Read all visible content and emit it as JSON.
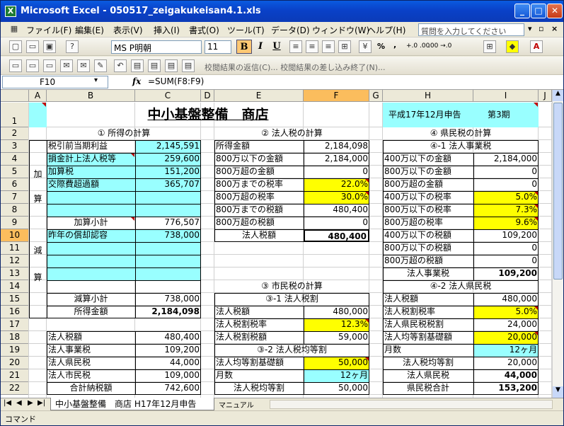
{
  "window": {
    "title": "Microsoft Excel - 050517_zeigakukeisan4.1.xls",
    "minimize": "_",
    "maximize": "□",
    "close": "✕"
  },
  "menu": {
    "items": [
      "ファイル(F)",
      "編集(E)",
      "表示(V)",
      "挿入(I)",
      "書式(O)",
      "ツール(T)",
      "データ(D)",
      "ウィンドウ(W)",
      "ヘルプ(H)"
    ],
    "help_placeholder": "質問を入力してください"
  },
  "toolbar": {
    "font_name": "MS P明朝",
    "font_size": "11",
    "bold": "B",
    "italic": "I",
    "underline": "U",
    "percent": "%",
    "comma": ",",
    "inc_dec": "+.0 .00",
    "dec_dec": ".00 →.0",
    "review_text": "校閲結果の返信(C)...  校閲結果の差し込み終了(N)..."
  },
  "formula_bar": {
    "name_box": "F10",
    "fx": "fx",
    "formula": "=SUM(F8:F9)"
  },
  "columns": [
    "A",
    "B",
    "C",
    "D",
    "E",
    "F",
    "G",
    "H",
    "I",
    "J"
  ],
  "rows": [
    "1",
    "2",
    "3",
    "4",
    "5",
    "6",
    "7",
    "8",
    "9",
    "10",
    "11",
    "12",
    "13",
    "14",
    "15",
    "16",
    "17",
    "18",
    "19",
    "20",
    "21",
    "22"
  ],
  "sheet": {
    "title": "中小基盤整備　商店",
    "period": "平成17年12月申告",
    "term": "第3期",
    "sec1": {
      "header": "① 所得の計算",
      "pretax_label": "税引前当期利益",
      "pretax_value": "2,145,591",
      "add_chars": [
        "加",
        "算"
      ],
      "sub_chars": [
        "減",
        "算"
      ],
      "add_items": [
        {
          "label": "損金計上法人税等",
          "value": "259,600"
        },
        {
          "label": "加算税",
          "value": "151,200"
        },
        {
          "label": "交際費超過額",
          "value": "365,707"
        },
        {
          "label": "",
          "value": ""
        },
        {
          "label": "",
          "value": ""
        }
      ],
      "add_subtotal_label": "加算小計",
      "add_subtotal_value": "776,507",
      "sub_items": [
        {
          "label": "昨年の償却認容",
          "value": "738,000"
        },
        {
          "label": "",
          "value": ""
        },
        {
          "label": "",
          "value": ""
        },
        {
          "label": "",
          "value": ""
        }
      ],
      "sub_subtotal_label": "減算小計",
      "sub_subtotal_value": "738,000",
      "income_label": "所得金額",
      "income_value": "2,184,098",
      "summary": [
        {
          "label": "法人税額",
          "value": "480,400"
        },
        {
          "label": "法人事業税",
          "value": "109,200"
        },
        {
          "label": "法人県民税",
          "value": "44,000"
        },
        {
          "label": "法人市民税",
          "value": "109,000"
        }
      ],
      "total_label": "合計納税額",
      "total_value": "742,600"
    },
    "sec2": {
      "header": "② 法人税の計算",
      "rows": [
        {
          "label": "所得金額",
          "value": "2,184,098"
        },
        {
          "label": "800万以下の金額",
          "value": "2,184,000"
        },
        {
          "label": "800万超の金額",
          "value": "0"
        },
        {
          "label": "800万までの税率",
          "value": "22.0%"
        },
        {
          "label": "800万超の税率",
          "value": "30.0%"
        },
        {
          "label": "800万までの税額",
          "value": "480,400"
        },
        {
          "label": "800万超の税額",
          "value": "0"
        }
      ],
      "total_label": "法人税額",
      "total_value": "480,400"
    },
    "sec3": {
      "header": "③ 市民税の計算",
      "sub1_header": "③-1 法人税割",
      "sub1_rows": [
        {
          "label": "法人税額",
          "value": "480,000"
        },
        {
          "label": "法人税割税率",
          "value": "12.3%"
        },
        {
          "label": "法人税割税額",
          "value": "59,000"
        }
      ],
      "sub2_header": "③-2 法人税均等割",
      "sub2_rows": [
        {
          "label": "法人均等割基礎額",
          "value": "50,000"
        },
        {
          "label": "月数",
          "value": "12ヶ月"
        }
      ],
      "per_capita_label": "法人税均等割",
      "per_capita_value": "50,000",
      "total_label": "法人市民税",
      "total_value": "109,000"
    },
    "sec4": {
      "header": "④ 県民税の計算",
      "sub1_header": "④-1 法人事業税",
      "sub1_rows": [
        {
          "label": "400万以下の金額",
          "value": "2,184,000"
        },
        {
          "label": "800万以下の金額",
          "value": "0"
        },
        {
          "label": "800万超の金額",
          "value": "0"
        },
        {
          "label": "400万以下の税率",
          "value": "5.0%"
        },
        {
          "label": "800万以下の税率",
          "value": "7.3%"
        },
        {
          "label": "800万超の税率",
          "value": "9.6%"
        },
        {
          "label": "400万以下の税額",
          "value": "109,200"
        },
        {
          "label": "800万以下の税額",
          "value": "0"
        },
        {
          "label": "800万超の税額",
          "value": "0"
        }
      ],
      "enterprise_label": "法人事業税",
      "enterprise_value": "109,200",
      "sub2_header": "④-2 法人県民税",
      "sub2_rows": [
        {
          "label": "法人税額",
          "value": "480,000"
        },
        {
          "label": "法人税割税率",
          "value": "5.0%"
        },
        {
          "label": "法人県民税税割",
          "value": "24,000"
        },
        {
          "label": "法人均等割基礎額",
          "value": "20,000"
        },
        {
          "label": "月数",
          "value": "12ヶ月"
        }
      ],
      "per_capita_label": "法人税均等割",
      "per_capita_value": "20,000",
      "pref_label": "法人県民税",
      "pref_value": "44,000",
      "total_label": "県民税合計",
      "total_value": "153,200"
    }
  },
  "tabs": {
    "active": "中小基盤整備　商店 H17年12月申告",
    "other": "マニュアル"
  },
  "status": {
    "text": "コマンド"
  }
}
